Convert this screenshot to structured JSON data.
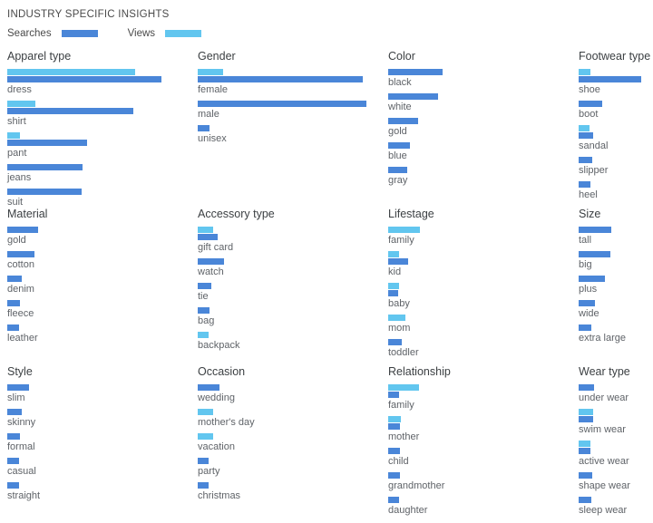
{
  "header": {
    "title": "INDUSTRY SPECIFIC INSIGHTS",
    "legend": [
      {
        "label": "Searches",
        "color": "#4a86d8",
        "key": "searches"
      },
      {
        "label": "Views",
        "color": "#62c6ef",
        "key": "views"
      }
    ]
  },
  "chart_data": {
    "type": "bar",
    "title": "INDUSTRY SPECIFIC INSIGHTS",
    "orientation": "horizontal",
    "grid": false,
    "legend_position": "top-left",
    "series_names": [
      "Searches",
      "Views"
    ],
    "series_colors": {
      "Searches": "#4a86d8",
      "Views": "#62c6ef"
    },
    "value_unit": "relative bar length (px at 720px width)",
    "panels": [
      {
        "title": "Apparel type",
        "rows": [
          {
            "label": "dress",
            "views": 141,
            "searches": 170
          },
          {
            "label": "shirt",
            "views": 31,
            "searches": 139
          },
          {
            "label": "pant",
            "views": 14,
            "searches": 88
          },
          {
            "label": "jeans",
            "views": 0,
            "searches": 83
          },
          {
            "label": "suit",
            "views": 0,
            "searches": 82
          }
        ]
      },
      {
        "title": "Gender",
        "rows": [
          {
            "label": "female",
            "views": 28,
            "searches": 182
          },
          {
            "label": "male",
            "views": 0,
            "searches": 186
          },
          {
            "label": "unisex",
            "views": 0,
            "searches": 13
          }
        ]
      },
      {
        "title": "Color",
        "rows": [
          {
            "label": "black",
            "views": 0,
            "searches": 60
          },
          {
            "label": "white",
            "views": 0,
            "searches": 55
          },
          {
            "label": "gold",
            "views": 0,
            "searches": 33
          },
          {
            "label": "blue",
            "views": 0,
            "searches": 24
          },
          {
            "label": "gray",
            "views": 0,
            "searches": 21
          }
        ]
      },
      {
        "title": "Footwear type",
        "rows": [
          {
            "label": "shoe",
            "views": 13,
            "searches": 69
          },
          {
            "label": "boot",
            "views": 0,
            "searches": 26
          },
          {
            "label": "sandal",
            "views": 12,
            "searches": 16
          },
          {
            "label": "slipper",
            "views": 0,
            "searches": 15
          },
          {
            "label": "heel",
            "views": 0,
            "searches": 13
          }
        ]
      },
      {
        "title": "Material",
        "rows": [
          {
            "label": "gold",
            "views": 0,
            "searches": 34
          },
          {
            "label": "cotton",
            "views": 0,
            "searches": 30
          },
          {
            "label": "denim",
            "views": 0,
            "searches": 16
          },
          {
            "label": "fleece",
            "views": 0,
            "searches": 14
          },
          {
            "label": "leather",
            "views": 0,
            "searches": 13
          }
        ]
      },
      {
        "title": "Accessory type",
        "rows": [
          {
            "label": "gift card",
            "views": 17,
            "searches": 22
          },
          {
            "label": "watch",
            "views": 0,
            "searches": 29
          },
          {
            "label": "tie",
            "views": 0,
            "searches": 15
          },
          {
            "label": "bag",
            "views": 0,
            "searches": 13
          },
          {
            "label": "backpack",
            "views": 12,
            "searches": 0
          }
        ]
      },
      {
        "title": "Lifestage",
        "rows": [
          {
            "label": "family",
            "views": 35,
            "searches": 0
          },
          {
            "label": "kid",
            "views": 12,
            "searches": 22
          },
          {
            "label": "baby",
            "views": 12,
            "searches": 11
          },
          {
            "label": "mom",
            "views": 19,
            "searches": 0
          },
          {
            "label": "toddler",
            "views": 0,
            "searches": 15
          }
        ]
      },
      {
        "title": "Size",
        "rows": [
          {
            "label": "tall",
            "views": 0,
            "searches": 36
          },
          {
            "label": "big",
            "views": 0,
            "searches": 35
          },
          {
            "label": "plus",
            "views": 0,
            "searches": 29
          },
          {
            "label": "wide",
            "views": 0,
            "searches": 18
          },
          {
            "label": "extra large",
            "views": 0,
            "searches": 14
          }
        ]
      },
      {
        "title": "Style",
        "rows": [
          {
            "label": "slim",
            "views": 0,
            "searches": 24
          },
          {
            "label": "skinny",
            "views": 0,
            "searches": 16
          },
          {
            "label": "formal",
            "views": 0,
            "searches": 14
          },
          {
            "label": "casual",
            "views": 0,
            "searches": 13
          },
          {
            "label": "straight",
            "views": 0,
            "searches": 13
          }
        ]
      },
      {
        "title": "Occasion",
        "rows": [
          {
            "label": "wedding",
            "views": 0,
            "searches": 24
          },
          {
            "label": "mother's day",
            "views": 17,
            "searches": 0
          },
          {
            "label": "vacation",
            "views": 17,
            "searches": 0
          },
          {
            "label": "party",
            "views": 0,
            "searches": 12
          },
          {
            "label": "christmas",
            "views": 0,
            "searches": 12
          }
        ]
      },
      {
        "title": "Relationship",
        "rows": [
          {
            "label": "family",
            "views": 34,
            "searches": 12
          },
          {
            "label": "mother",
            "views": 14,
            "searches": 13
          },
          {
            "label": "child",
            "views": 0,
            "searches": 13
          },
          {
            "label": "grandmother",
            "views": 0,
            "searches": 13
          },
          {
            "label": "daughter",
            "views": 0,
            "searches": 12
          }
        ]
      },
      {
        "title": "Wear type",
        "rows": [
          {
            "label": "under wear",
            "views": 0,
            "searches": 17
          },
          {
            "label": "swim wear",
            "views": 16,
            "searches": 16
          },
          {
            "label": "active wear",
            "views": 13,
            "searches": 13
          },
          {
            "label": "shape wear",
            "views": 0,
            "searches": 15
          },
          {
            "label": "sleep wear",
            "views": 0,
            "searches": 14
          }
        ]
      }
    ]
  }
}
